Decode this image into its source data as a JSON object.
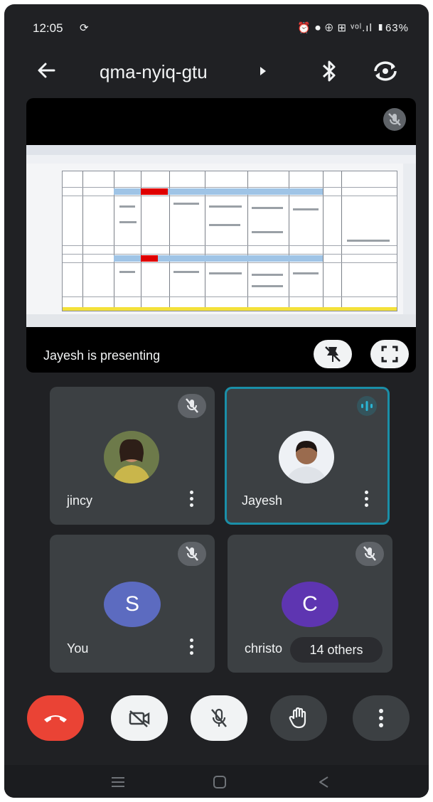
{
  "status_bar": {
    "time": "12:05",
    "sync_glyph": "⟳",
    "icons_text": "⏰ ⏺ ⊕ ⊞ ᵛᵒˡ.ıl ▮63%",
    "battery": "63%"
  },
  "header": {
    "meeting_code": "qma-nyiq-gtu"
  },
  "presentation": {
    "status_text": "Jayesh is presenting"
  },
  "participants": [
    {
      "name": "jincy",
      "avatar_type": "photo",
      "muted": true
    },
    {
      "name": "Jayesh",
      "avatar_type": "photo",
      "speaking": true
    },
    {
      "name": "You",
      "avatar_type": "letter",
      "initial": "S",
      "color": "#5c6bc0",
      "muted": true
    },
    {
      "name": "christo",
      "avatar_type": "letter",
      "initial": "C",
      "color": "#5e35b1",
      "muted": true
    }
  ],
  "others_chip": "14 others",
  "controls": [
    {
      "name": "end-call",
      "color": "#ea4335"
    },
    {
      "name": "camera-off",
      "color": "#f1f3f4"
    },
    {
      "name": "mic-off",
      "color": "#f1f3f4"
    },
    {
      "name": "raise-hand",
      "color": "#3c4043"
    },
    {
      "name": "more-options",
      "color": "#3c4043"
    }
  ],
  "colors": {
    "background": "#202124",
    "tile": "#3c4043",
    "active_border": "#1a8fa8"
  }
}
